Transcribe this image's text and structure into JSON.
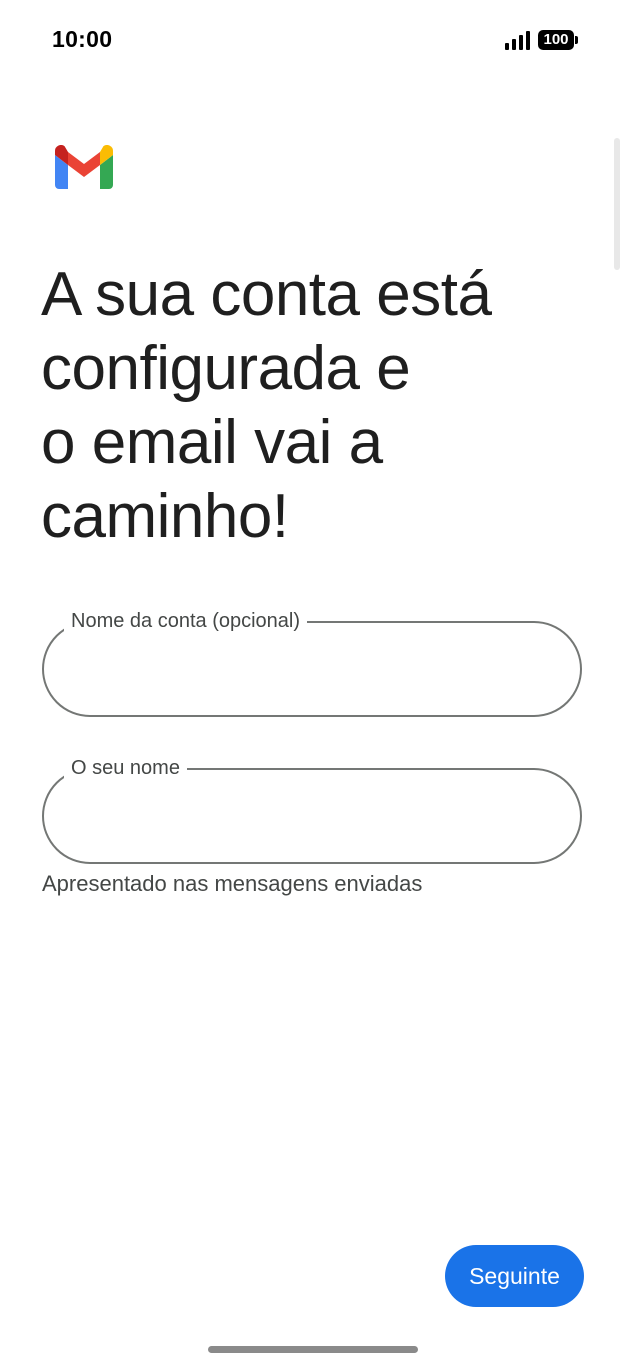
{
  "status_bar": {
    "time": "10:00",
    "battery": "100",
    "icons": [
      "signal-icon",
      "battery-icon"
    ]
  },
  "logo": {
    "name": "gmail-logo",
    "colors": {
      "blue": "#4285F4",
      "red": "#EA4335",
      "yellow": "#FBBC04",
      "green": "#34A853",
      "dark_red": "#C5221F"
    }
  },
  "headline": "A sua conta está\nconfigurada e\no email vai a\ncaminho!",
  "fields": {
    "account_name": {
      "label": "Nome da conta (opcional)",
      "value": ""
    },
    "your_name": {
      "label": "O seu nome",
      "value": "",
      "helper": "Apresentado nas mensagens enviadas"
    }
  },
  "next_button": {
    "label": "Seguinte",
    "color": "#1a73e8"
  }
}
